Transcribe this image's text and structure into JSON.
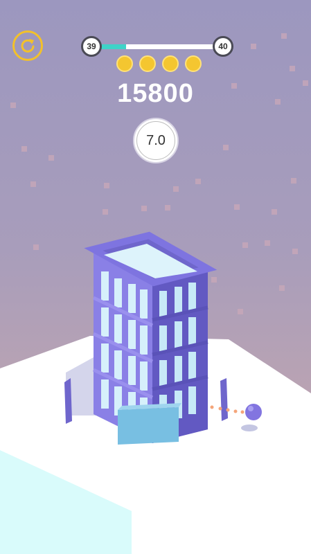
{
  "hud": {
    "current_level": "39",
    "next_level": "40",
    "level_progress": 0.23,
    "coins_collected": 4,
    "score": "15800",
    "timer": "7.0"
  },
  "icons": {
    "restart": "restart-icon"
  },
  "colors": {
    "accent_yellow": "#f3c12a",
    "progress_fill": "#3ed3c8",
    "tower_purple": "#7a70d8",
    "glass_blue": "#bfe6f5",
    "ball": "#8275e0"
  }
}
